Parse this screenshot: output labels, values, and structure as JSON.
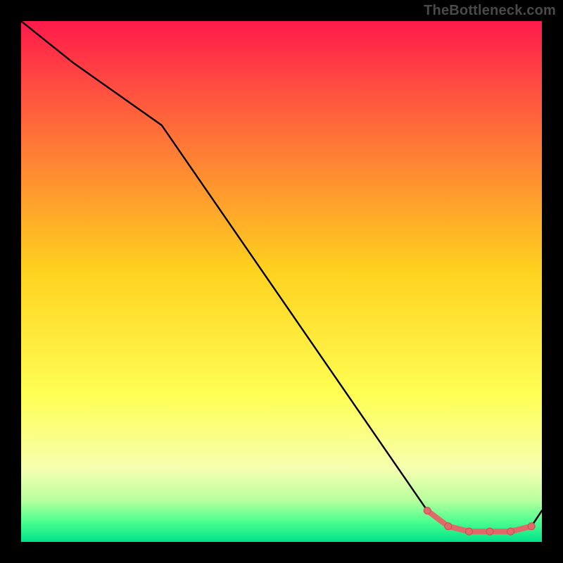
{
  "watermark": "TheBottleneck.com",
  "colors": {
    "page_bg": "#000000",
    "watermark": "#4a4a4a",
    "curve": "#000000",
    "marker_fill": "#e06a6a",
    "marker_stroke": "#c94f4f",
    "gradient_top": "#ff1a4b",
    "gradient_mid_upper": "#ff6a3a",
    "gradient_mid": "#ffd21f",
    "gradient_mid_lower": "#ffff55",
    "gradient_low": "#f6ffb0",
    "gradient_green1": "#b8ff9e",
    "gradient_green2": "#4fff8f",
    "gradient_bottom": "#00e38a"
  },
  "chart_data": {
    "type": "line",
    "title": "",
    "xlabel": "",
    "ylabel": "",
    "xlim": [
      0,
      100
    ],
    "ylim": [
      0,
      100
    ],
    "series": [
      {
        "name": "bottleneck-curve",
        "x": [
          0,
          10,
          27,
          78,
          82,
          86,
          90,
          94,
          98,
          100
        ],
        "y": [
          100,
          92,
          80,
          6,
          3,
          2,
          2,
          2,
          3,
          6
        ]
      }
    ],
    "markers": [
      {
        "name": "range-start",
        "x": 78,
        "y": 6
      },
      {
        "name": "range-dot-1",
        "x": 82,
        "y": 3
      },
      {
        "name": "range-dot-2",
        "x": 86,
        "y": 2
      },
      {
        "name": "range-dot-3",
        "x": 90,
        "y": 2
      },
      {
        "name": "range-dot-4",
        "x": 94,
        "y": 2
      },
      {
        "name": "range-end",
        "x": 98,
        "y": 3
      }
    ]
  }
}
